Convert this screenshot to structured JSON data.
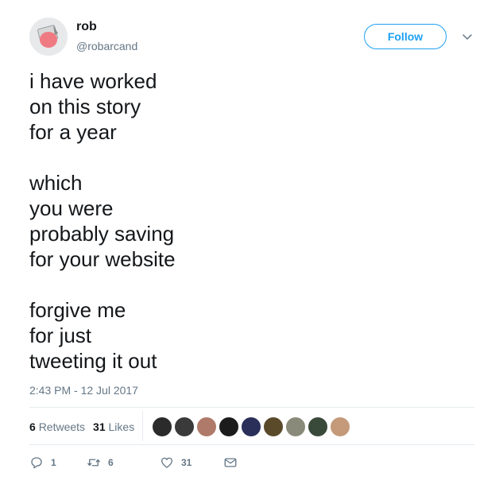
{
  "user": {
    "name": "rob",
    "handle": "@robarcand"
  },
  "follow_label": "Follow",
  "tweet": {
    "lines": [
      "i have worked",
      "on this story",
      "for a year",
      "",
      "which",
      "you were",
      "probably saving",
      "for your website",
      "",
      "forgive me",
      "for just",
      "tweeting it out"
    ],
    "timestamp": "2:43 PM - 12 Jul 2017"
  },
  "stats": {
    "retweets_count": "6",
    "retweets_label": "Retweets",
    "likes_count": "31",
    "likes_label": "Likes"
  },
  "likers_avatar_colors": [
    "#2b2b2b",
    "#3a3a3a",
    "#b07a6a",
    "#1c1c1c",
    "#2a2f5a",
    "#5a4a2a",
    "#8a8a7a",
    "#3a4a3a",
    "#c49a7a"
  ],
  "actions": {
    "reply_count": "1",
    "retweet_count": "6",
    "like_count": "31"
  },
  "icons": {
    "reply": "reply-icon",
    "retweet": "retweet-icon",
    "like": "heart-icon",
    "dm": "envelope-icon",
    "menu": "chevron-down-icon"
  },
  "colors": {
    "accent": "#1da1f2",
    "secondary_text": "#657786",
    "primary_text": "#14171a",
    "divider": "#e6ecf0"
  }
}
